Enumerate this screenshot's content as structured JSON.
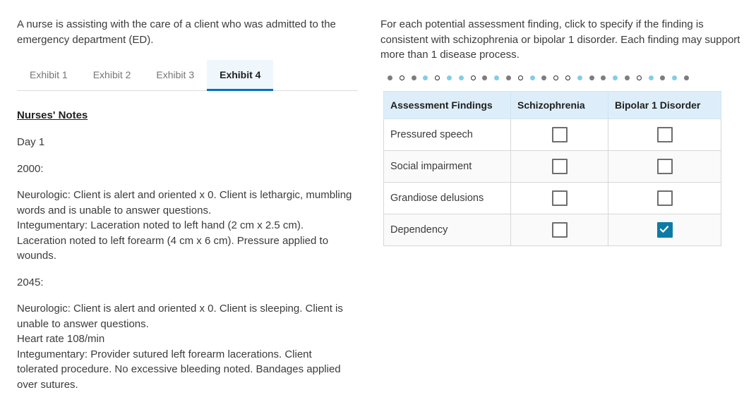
{
  "left": {
    "scenario": "A nurse is assisting with the care of a client who was admitted to the emergency department (ED).",
    "tabs": [
      {
        "label": "Exhibit 1",
        "active": false
      },
      {
        "label": "Exhibit 2",
        "active": false
      },
      {
        "label": "Exhibit 3",
        "active": false
      },
      {
        "label": "Exhibit 4",
        "active": true
      }
    ],
    "notes_title": "Nurses' Notes",
    "notes": [
      "Day 1",
      "2000:",
      "Neurologic: Client is alert and oriented x 0. Client is lethargic, mumbling words and is unable to answer questions.\nIntegumentary: Laceration noted to left hand (2 cm x 2.5 cm). Laceration noted to left forearm (4 cm x 6 cm). Pressure applied to wounds.",
      "2045:",
      "Neurologic: Client is alert and oriented x 0. Client is sleeping. Client is unable to answer questions.\nHeart rate 108/min\nIntegumentary: Provider sutured left forearm lacerations. Client tolerated procedure. No excessive bleeding noted. Bandages applied over sutures."
    ]
  },
  "right": {
    "instructions": "For each potential assessment finding, click to specify if the finding is consistent with schizophrenia or bipolar 1 disorder. Each finding may support more than 1 disease process.",
    "dots": [
      "gray",
      "hollow",
      "gray",
      "blue",
      "hollow",
      "blue",
      "blue",
      "hollow",
      "gray",
      "blue",
      "gray",
      "hollow",
      "blue",
      "gray",
      "hollow",
      "hollow",
      "blue",
      "gray",
      "gray",
      "blue",
      "gray",
      "hollow",
      "blue",
      "gray",
      "blue",
      "gray"
    ],
    "table": {
      "headers": [
        "Assessment Findings",
        "Schizophrenia",
        "Bipolar 1 Disorder"
      ],
      "rows": [
        {
          "finding": "Pressured speech",
          "schizophrenia": false,
          "bipolar": false
        },
        {
          "finding": "Social impairment",
          "schizophrenia": false,
          "bipolar": false
        },
        {
          "finding": "Grandiose delusions",
          "schizophrenia": false,
          "bipolar": false
        },
        {
          "finding": "Dependency",
          "schizophrenia": false,
          "bipolar": true
        }
      ]
    }
  },
  "colors": {
    "accent_blue": "#0072c0",
    "tab_active_bg": "#eff7fc",
    "header_bg": "#ddeefa",
    "checked_teal": "#0d7ba6",
    "dot_blue": "#84cde4",
    "dot_gray": "#7d7d7d"
  }
}
